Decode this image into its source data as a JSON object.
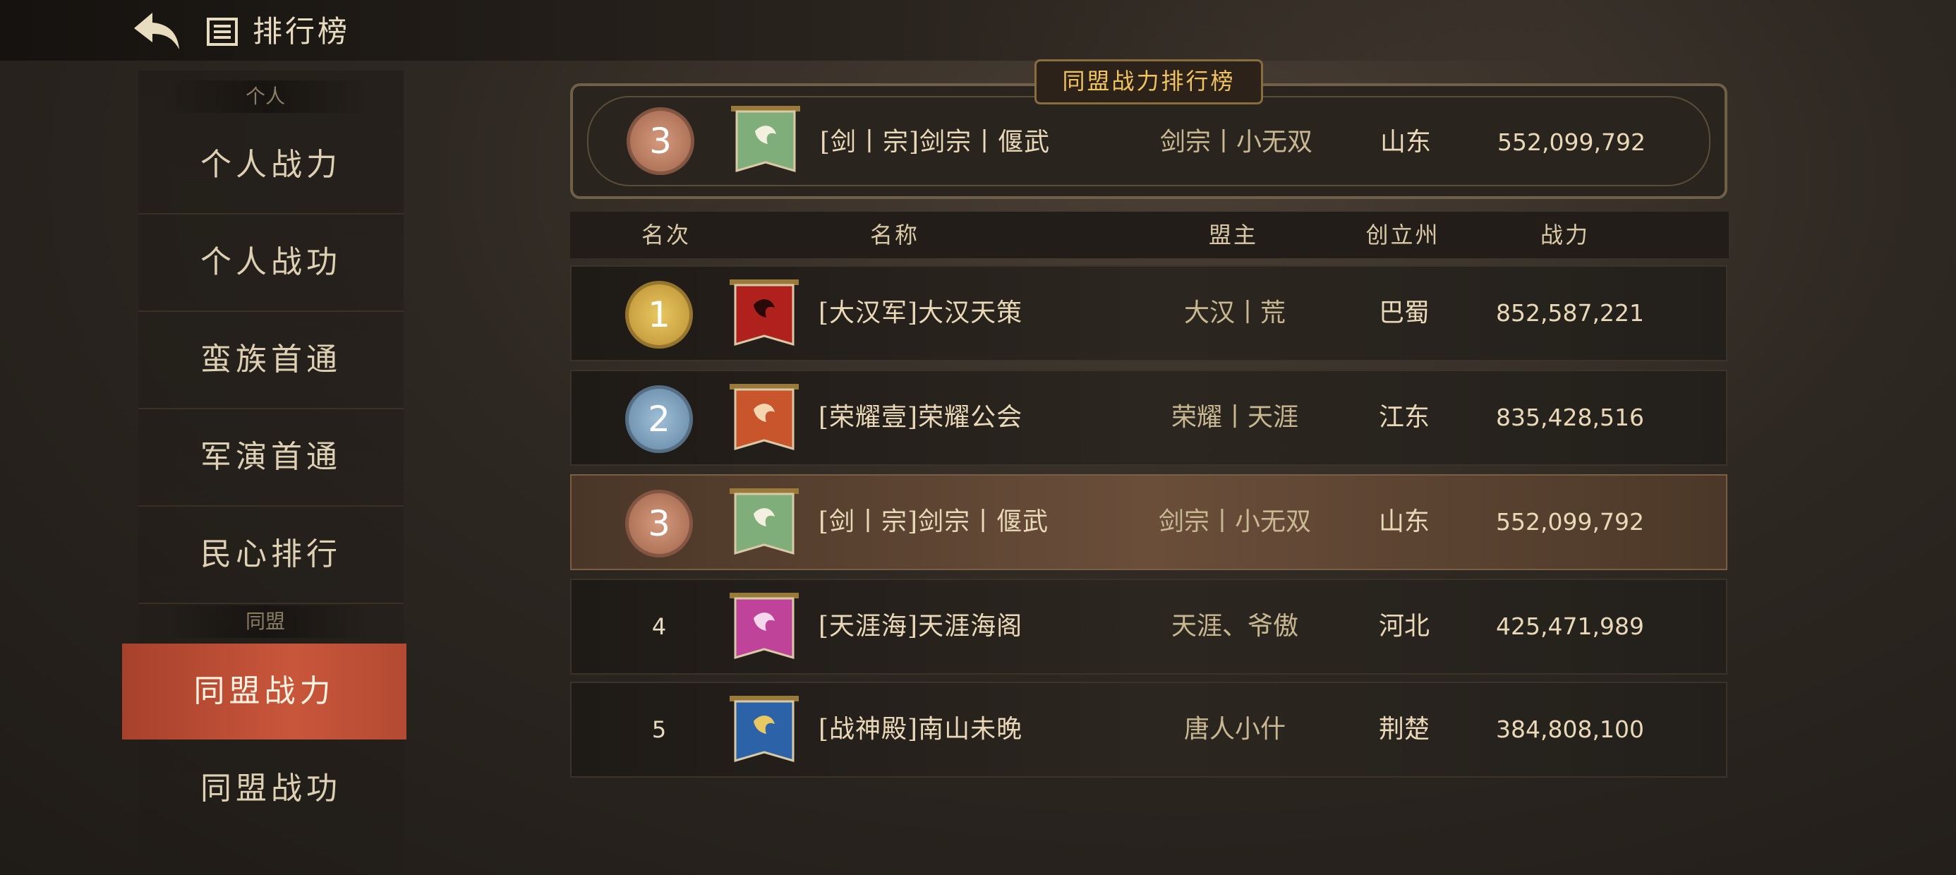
{
  "header": {
    "title": "排行榜",
    "back_icon": "back-arrow-icon",
    "list_icon": "list-icon"
  },
  "sidebar": {
    "section_personal": "个人",
    "section_alliance": "同盟",
    "items": [
      {
        "label": "个人战力"
      },
      {
        "label": "个人战功"
      },
      {
        "label": "蛮族首通"
      },
      {
        "label": "军演首通"
      },
      {
        "label": "民心排行"
      },
      {
        "label": "同盟战力",
        "active": true
      },
      {
        "label": "同盟战功"
      }
    ]
  },
  "board": {
    "banner": "同盟战力排行榜",
    "columns": [
      "名次",
      "名称",
      "盟主",
      "创立州",
      "战力"
    ],
    "my_alliance": {
      "rank": "3",
      "name": "[剑丨宗]剑宗丨偃武",
      "leader": "剑宗丨小无双",
      "state": "山东",
      "power": "552,099,792",
      "flag_color": "#7fae7a"
    },
    "rows": [
      {
        "rank": "1",
        "name": "[大汉军]大汉天策",
        "leader": "大汉丨荒",
        "state": "巴蜀",
        "power": "852,587,221",
        "flag_color": "#b0201c",
        "medal": "gold-medal-icon"
      },
      {
        "rank": "2",
        "name": "[荣耀壹]荣耀公会",
        "leader": "荣耀丨天涯",
        "state": "江东",
        "power": "835,428,516",
        "flag_color": "#c8552c",
        "medal": "silver-medal-icon"
      },
      {
        "rank": "3",
        "name": "[剑丨宗]剑宗丨偃武",
        "leader": "剑宗丨小无双",
        "state": "山东",
        "power": "552,099,792",
        "flag_color": "#7fae7a",
        "medal": "bronze-medal-icon",
        "highlight": true
      },
      {
        "rank": "4",
        "name": "[天涯海]天涯海阁",
        "leader": "天涯、爷傲",
        "state": "河北",
        "power": "425,471,989",
        "flag_color": "#c0439a"
      },
      {
        "rank": "5",
        "name": "[战神殿]南山未晚",
        "leader": "唐人小什",
        "state": "荆楚",
        "power": "384,808,100",
        "flag_color": "#2c62a8"
      }
    ]
  }
}
